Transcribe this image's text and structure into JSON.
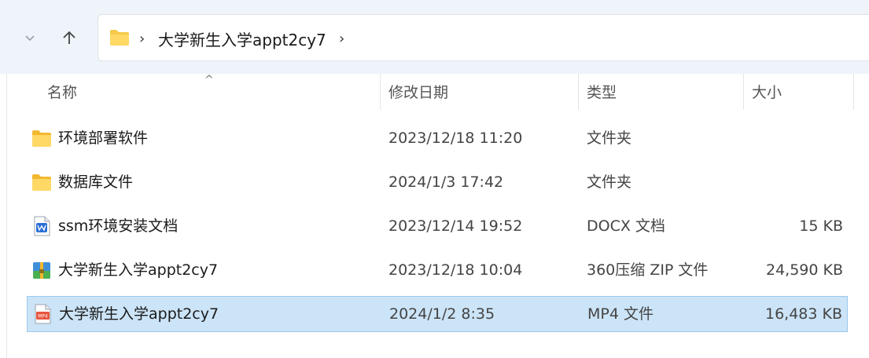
{
  "breadcrumb": {
    "current": "大学新生入学appt2cy7"
  },
  "columns": {
    "name": "名称",
    "date": "修改日期",
    "type": "类型",
    "size": "大小"
  },
  "files": [
    {
      "name": "环境部署软件",
      "date": "2023/12/18 11:20",
      "type": "文件夹",
      "size": "",
      "icon": "folder-icon"
    },
    {
      "name": "数据库文件",
      "date": "2024/1/3 17:42",
      "type": "文件夹",
      "size": "",
      "icon": "folder-icon"
    },
    {
      "name": "ssm环境安装文档",
      "date": "2023/12/14 19:52",
      "type": "DOCX 文档",
      "size": "15 KB",
      "icon": "docx-icon"
    },
    {
      "name": "大学新生入学appt2cy7",
      "date": "2023/12/18 10:04",
      "type": "360压缩 ZIP 文件",
      "size": "24,590 KB",
      "icon": "zip-icon"
    },
    {
      "name": "大学新生入学appt2cy7",
      "date": "2024/1/2 8:35",
      "type": "MP4 文件",
      "size": "16,483 KB",
      "icon": "mp4-icon",
      "selected": true
    }
  ],
  "colors": {
    "selection": "#cce4f7",
    "selection_border": "#99c9ef",
    "topbar": "#eef4f9",
    "folder": "#f6c94a"
  }
}
